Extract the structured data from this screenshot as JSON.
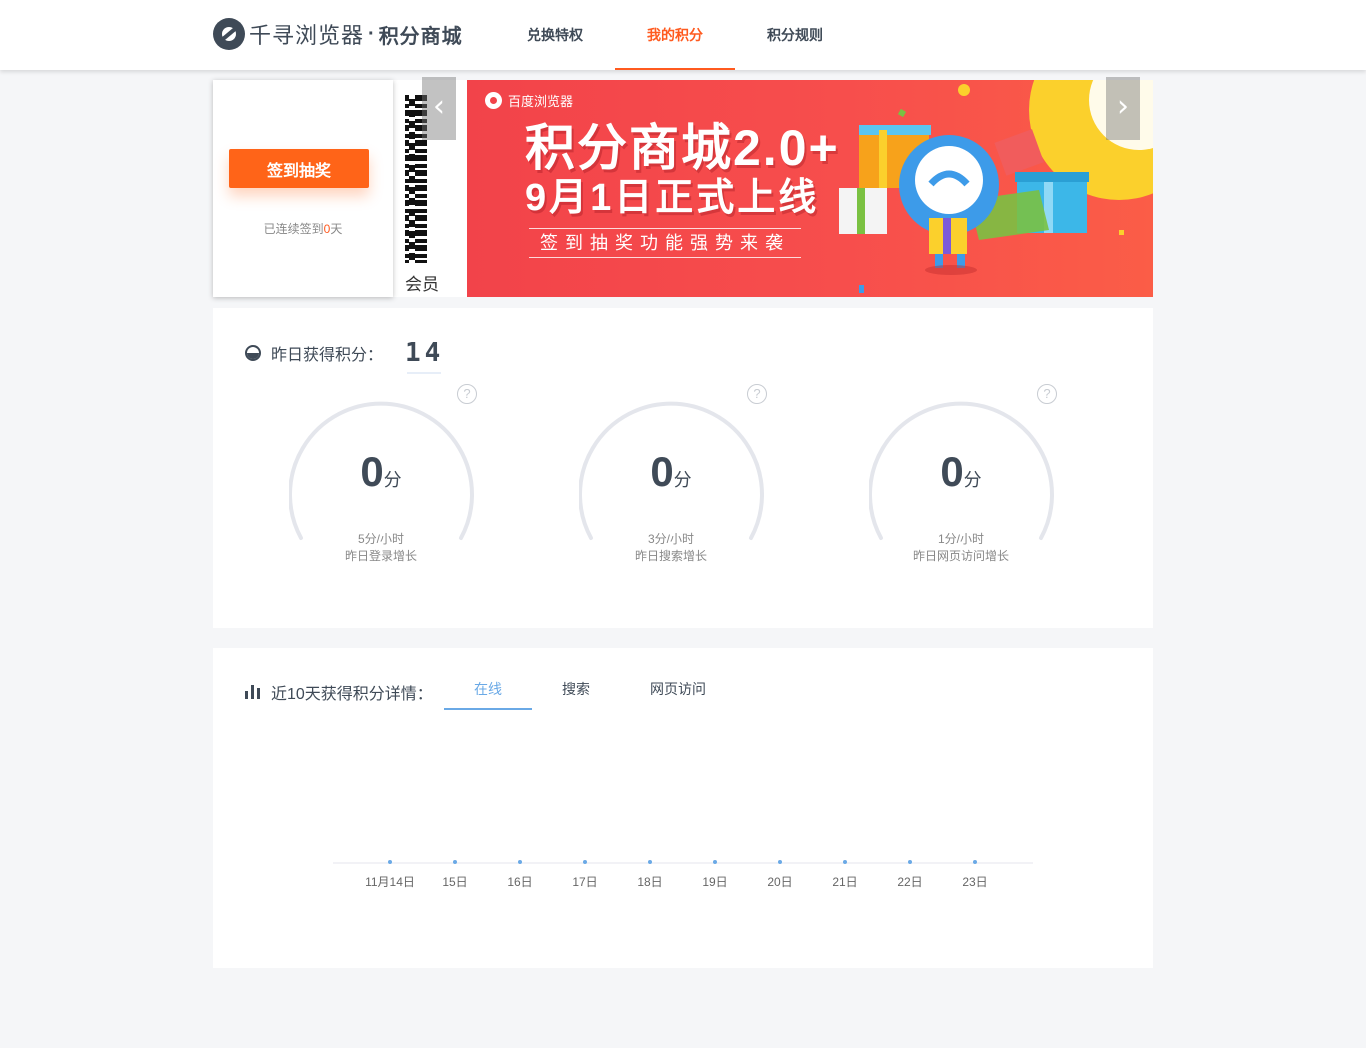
{
  "header": {
    "logo_name": "千寻浏览器",
    "logo_dot": "·",
    "logo_sub": "积分商城",
    "nav": [
      {
        "label": "兑换特权",
        "active": false
      },
      {
        "label": "我的积分",
        "active": true
      },
      {
        "label": "积分规则",
        "active": false
      }
    ]
  },
  "signin": {
    "button_label": "签到抽奖",
    "streak_prefix": "已连续签到",
    "streak_days": "0",
    "streak_suffix": "天"
  },
  "banner": {
    "side_text": "会员",
    "brand": "百度浏览器",
    "title": "积分商城2.0+",
    "date_line": "9月1日正式上线",
    "tagline": "签到抽奖功能强势来袭",
    "prev_icon": "chevron-left-icon",
    "next_icon": "chevron-right-icon"
  },
  "yesterday": {
    "label": "昨日获得积分：",
    "value": "14",
    "gauges": [
      {
        "value": "0",
        "unit": "分",
        "rate": "5分/小时",
        "desc": "昨日登录增长",
        "help": "?"
      },
      {
        "value": "0",
        "unit": "分",
        "rate": "3分/小时",
        "desc": "昨日搜索增长",
        "help": "?"
      },
      {
        "value": "0",
        "unit": "分",
        "rate": "1分/小时",
        "desc": "昨日网页访问增长",
        "help": "?"
      }
    ]
  },
  "details": {
    "label": "近10天获得积分详情：",
    "tabs": [
      {
        "label": "在线",
        "active": true
      },
      {
        "label": "搜索",
        "active": false
      },
      {
        "label": "网页访问",
        "active": false
      }
    ]
  },
  "colors": {
    "accent": "#ff5a1f",
    "signin_button": "#ff6418",
    "tab_active": "#6aa9e6",
    "text_dark": "#3f4a57",
    "gauge_track": "#e4e6ec"
  },
  "chart_data": {
    "type": "line",
    "categories": [
      "11月14日",
      "15日",
      "16日",
      "17日",
      "18日",
      "19日",
      "20日",
      "21日",
      "22日",
      "23日"
    ],
    "series": [
      {
        "values": [
          0,
          0,
          0,
          0,
          0,
          0,
          0,
          0,
          0,
          0
        ]
      }
    ],
    "grid": false,
    "point_color": "#6aa9e6"
  }
}
